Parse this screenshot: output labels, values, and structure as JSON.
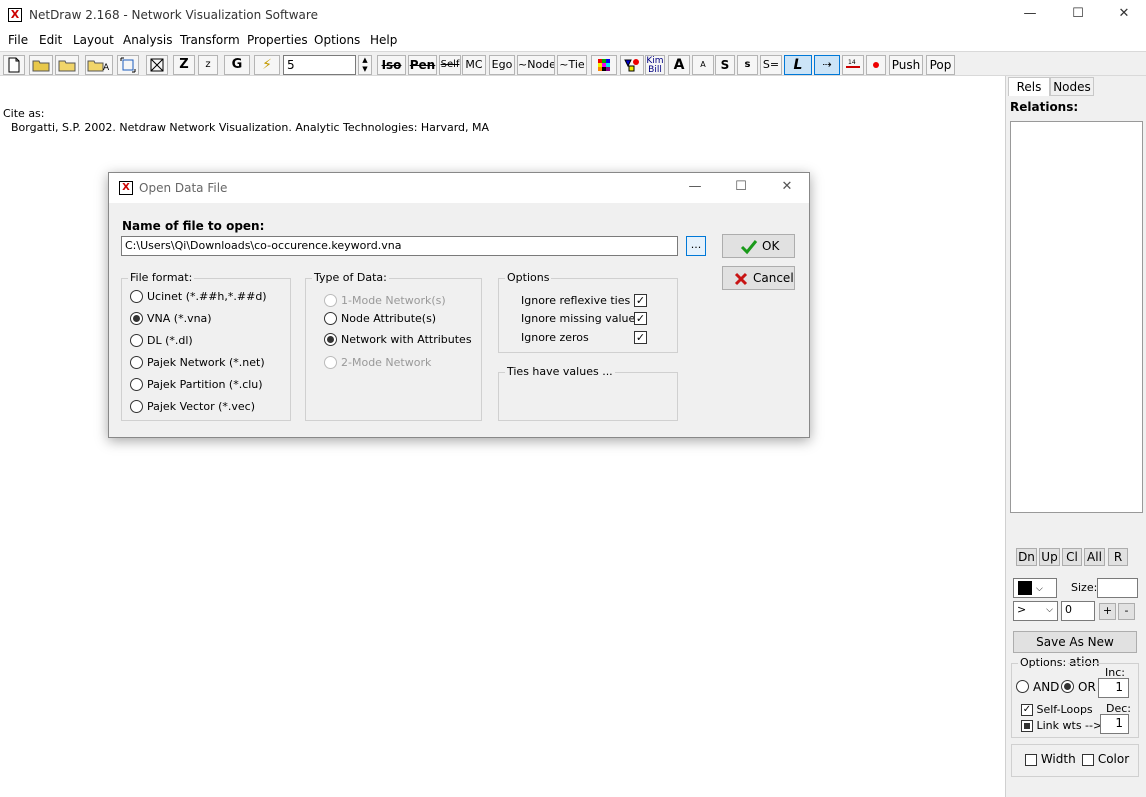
{
  "app": {
    "title": "NetDraw 2.168 - Network Visualization Software",
    "icon_text": "X"
  },
  "window_controls": {
    "minimize": "—",
    "maximize": "☐",
    "close": "✕"
  },
  "menu": [
    "File",
    "Edit",
    "Layout",
    "Analysis",
    "Transform",
    "Properties",
    "Options",
    "Help"
  ],
  "toolbar": {
    "zoom_big": "Z",
    "zoom_small": "z",
    "g": "G",
    "lightning": "⚡",
    "value": "5",
    "iso": "Iso",
    "pen": "Pen",
    "self": "Self",
    "mc": "MC",
    "ego": "Ego",
    "node": "~Node",
    "tie": "~Tie",
    "kim": "Kim",
    "bill": "Bill",
    "big_a": "A",
    "small_a": "A",
    "big_s": "S",
    "small_s": "s",
    "s_eq": "S=",
    "l": "L",
    "arrow": "⇢",
    "push": "Push",
    "pop": "Pop"
  },
  "cite": {
    "heading": "Cite as:",
    "text": "Borgatti, S.P. 2002. Netdraw Network Visualization. Analytic Technologies: Harvard, MA"
  },
  "right_panel": {
    "tabs": [
      "Rels",
      "Nodes"
    ],
    "relations_label": "Relations:",
    "buttons": [
      "Dn",
      "Up",
      "Cl",
      "All",
      "R"
    ],
    "size_label": "Size:",
    "arrow_select": ">",
    "num_value": "0",
    "plus": "+",
    "minus": "-",
    "save_relation": "Save As New Relation",
    "options_label": "Options:",
    "inc_label": "Inc:",
    "and_label": "AND",
    "or_label": "OR",
    "inc_value": "1",
    "self_loops": "Self-Loops",
    "dec_label": "Dec:",
    "link_wts": "Link wts -->",
    "dec_value": "1",
    "width_label": "Width",
    "color_label": "Color"
  },
  "dialog": {
    "title": "Open Data File",
    "file_label": "Name of file to open:",
    "file_value": "C:\\Users\\Qi\\Downloads\\co-occurence.keyword.vna",
    "browse": "...",
    "ok": "OK",
    "cancel": "Cancel",
    "file_format": {
      "title": "File format:",
      "options": [
        "Ucinet (*.##h,*.##d)",
        "VNA (*.vna)",
        "DL (*.dl)",
        "Pajek Network (*.net)",
        "Pajek Partition (*.clu)",
        "Pajek Vector (*.vec)"
      ],
      "selected": 1
    },
    "type_of_data": {
      "title": "Type of Data:",
      "options": [
        "1-Mode Network(s)",
        "Node Attribute(s)",
        "Network with Attributes",
        "2-Mode Network"
      ],
      "selected": 2
    },
    "options": {
      "title": "Options",
      "items": [
        "Ignore reflexive ties",
        "Ignore missing values",
        "Ignore zeros"
      ]
    },
    "ties_title": "Ties have values ..."
  }
}
